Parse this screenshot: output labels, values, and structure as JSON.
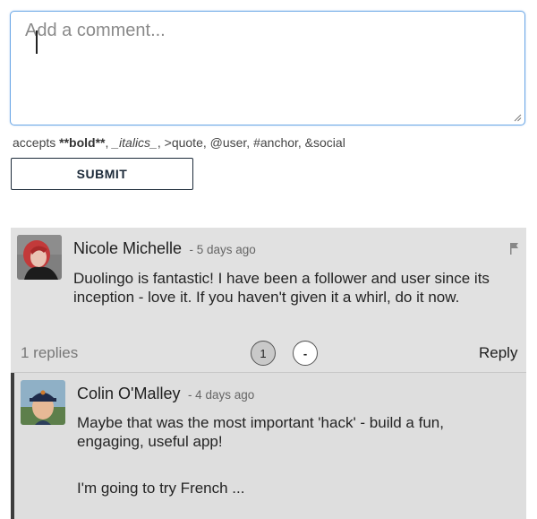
{
  "comment_form": {
    "placeholder": "Add a comment...",
    "value": "",
    "accepts_prefix": "accepts",
    "accepts_bold": "**bold**",
    "accepts_sep1": ",",
    "accepts_italics": "_italics_",
    "accepts_rest": ", >quote, @user, #anchor, &social",
    "submit_label": "SUBMIT"
  },
  "comments": [
    {
      "author": "Nicole Michelle",
      "time": "- 5 days ago",
      "body": "Duolingo is fantastic! I have been a follower and user since its inception - love it. If you haven't given it a whirl, do it now.",
      "replies_label": "1 replies",
      "page_button": "1",
      "collapse_button": "-",
      "reply_label": "Reply",
      "flag_icon": "flag-icon",
      "reply": {
        "author": "Colin O'Malley",
        "time": "- 4 days ago",
        "body_line1": "Maybe that was the most important 'hack' - build a fun, engaging, useful app!",
        "body_line2": "I'm going to try French ..."
      }
    }
  ],
  "colors": {
    "focus_border": "#6aa7e6",
    "thread_bg": "#e1e1e1",
    "button_border": "#1d2b3a",
    "nested_bar": "#3d3d3d"
  }
}
